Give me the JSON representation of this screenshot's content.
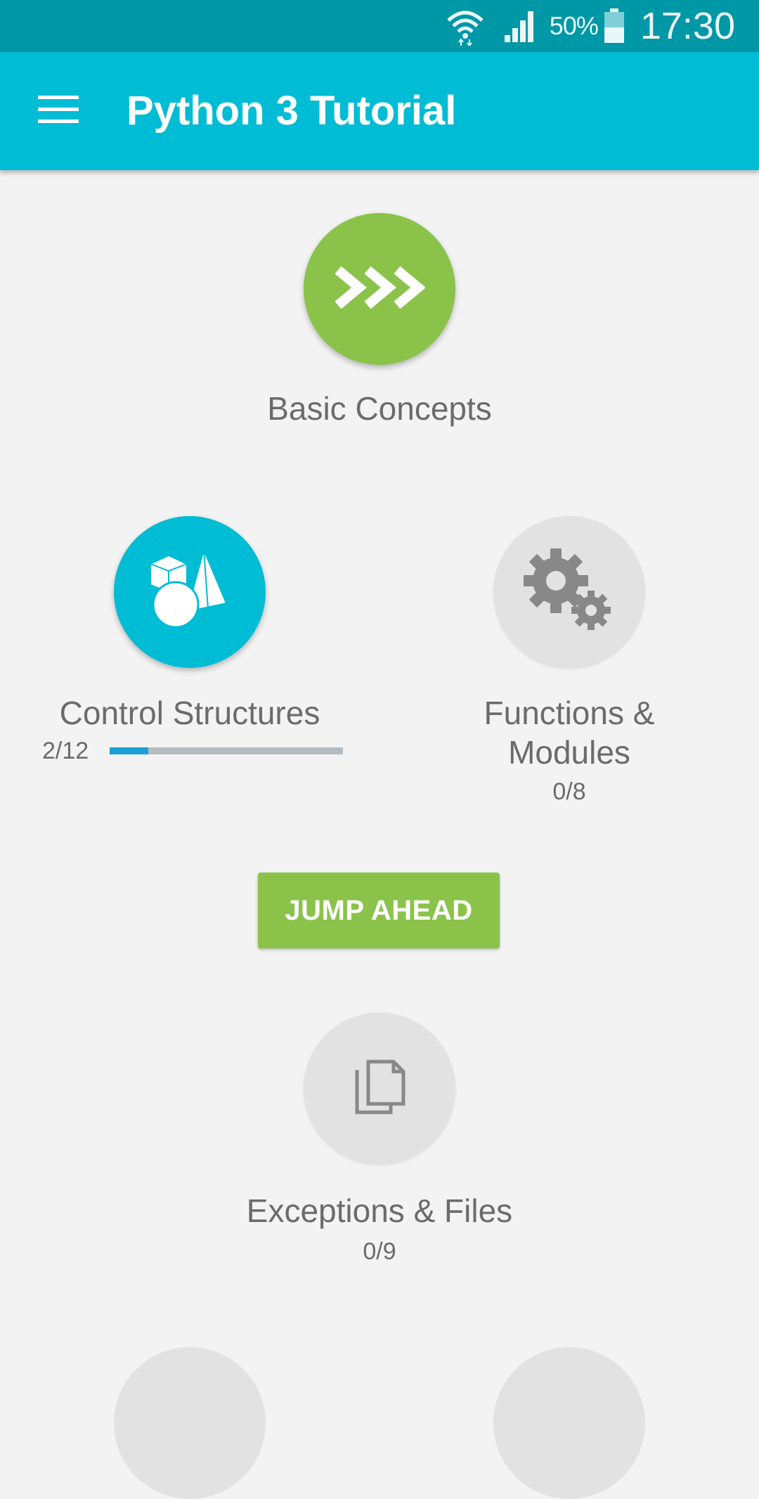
{
  "status_bar": {
    "battery_percent": "50%",
    "battery_level": 0.5,
    "time": "17:30",
    "icons": [
      "wifi-icon",
      "signal-icon",
      "battery-icon"
    ]
  },
  "app_bar": {
    "title": "Python 3 Tutorial",
    "menu_icon": "hamburger-menu-icon",
    "background": "#00bcd4"
  },
  "modules": {
    "basic_concepts": {
      "label": "Basic Concepts",
      "icon": "python-prompt-icon",
      "icon_text": ">>>",
      "color": "#8bc34a"
    },
    "control_structures": {
      "label": "Control Structures",
      "count": "2/12",
      "progress": 0.1667,
      "icon": "shapes-icon",
      "color": "#00bcd4"
    },
    "functions_modules": {
      "label_line1": "Functions &",
      "label_line2": "Modules",
      "count": "0/8",
      "icon": "gears-icon",
      "color": "#e2e2e2"
    },
    "exceptions_files": {
      "label": "Exceptions & Files",
      "count": "0/9",
      "icon": "documents-icon",
      "color": "#e2e2e2"
    }
  },
  "jump_ahead": {
    "label": "JUMP AHEAD",
    "color": "#8bc34a"
  }
}
